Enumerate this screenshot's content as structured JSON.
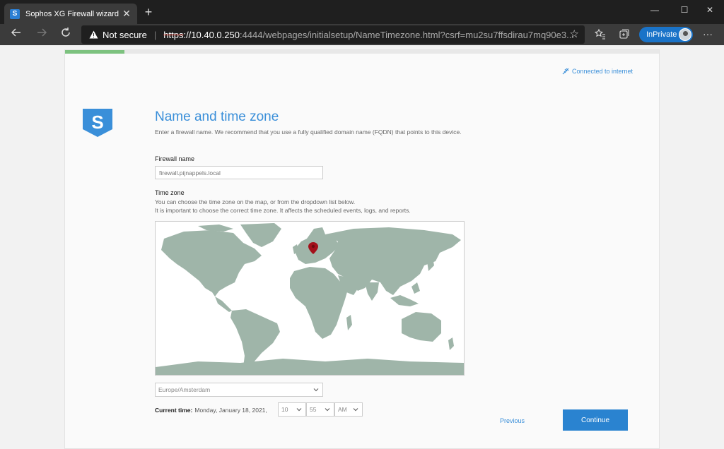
{
  "browser": {
    "tab_title": "Sophos XG Firewall wizard",
    "tab_favicon_letter": "S",
    "tab_close": "✕",
    "new_tab": "+",
    "window_controls": {
      "minimize": "—",
      "maximize": "☐",
      "close": "✕"
    },
    "security_label": "Not secure",
    "url_scheme": "https",
    "url_host": "://10.40.0.250",
    "url_rest": ":4444/webpages/initialsetup/NameTimezone.html?csrf=mu2su7ffsdirau7mq90e3...",
    "inprivate_label": "InPrivate",
    "more": "···",
    "accent": "#1a73c8"
  },
  "wizard": {
    "progress": 0.1,
    "connection_status": "Connected to internet",
    "logo_letter": "S",
    "title": "Name and time zone",
    "subtitle": "Enter a firewall name. We recommend that you use a fully qualified domain name (FQDN) that points to this device.",
    "firewall_name_label": "Firewall name",
    "firewall_name_placeholder": "firewall.pijnappels.local",
    "timezone_label": "Time zone",
    "timezone_help_1": "You can choose the time zone on the map, or from the dropdown list below.",
    "timezone_help_2": "It is important to choose the correct time zone. It affects the scheduled events, logs, and reports.",
    "timezone_value": "Europe/Amsterdam",
    "current_time_label": "Current time:",
    "current_date": "Monday, January 18, 2021,",
    "hour": "10",
    "minute": "55",
    "ampm": "AM",
    "previous_label": "Previous",
    "continue_label": "Continue",
    "brand_color": "#3a8fd9",
    "map_land_color": "#9fb5a9"
  }
}
